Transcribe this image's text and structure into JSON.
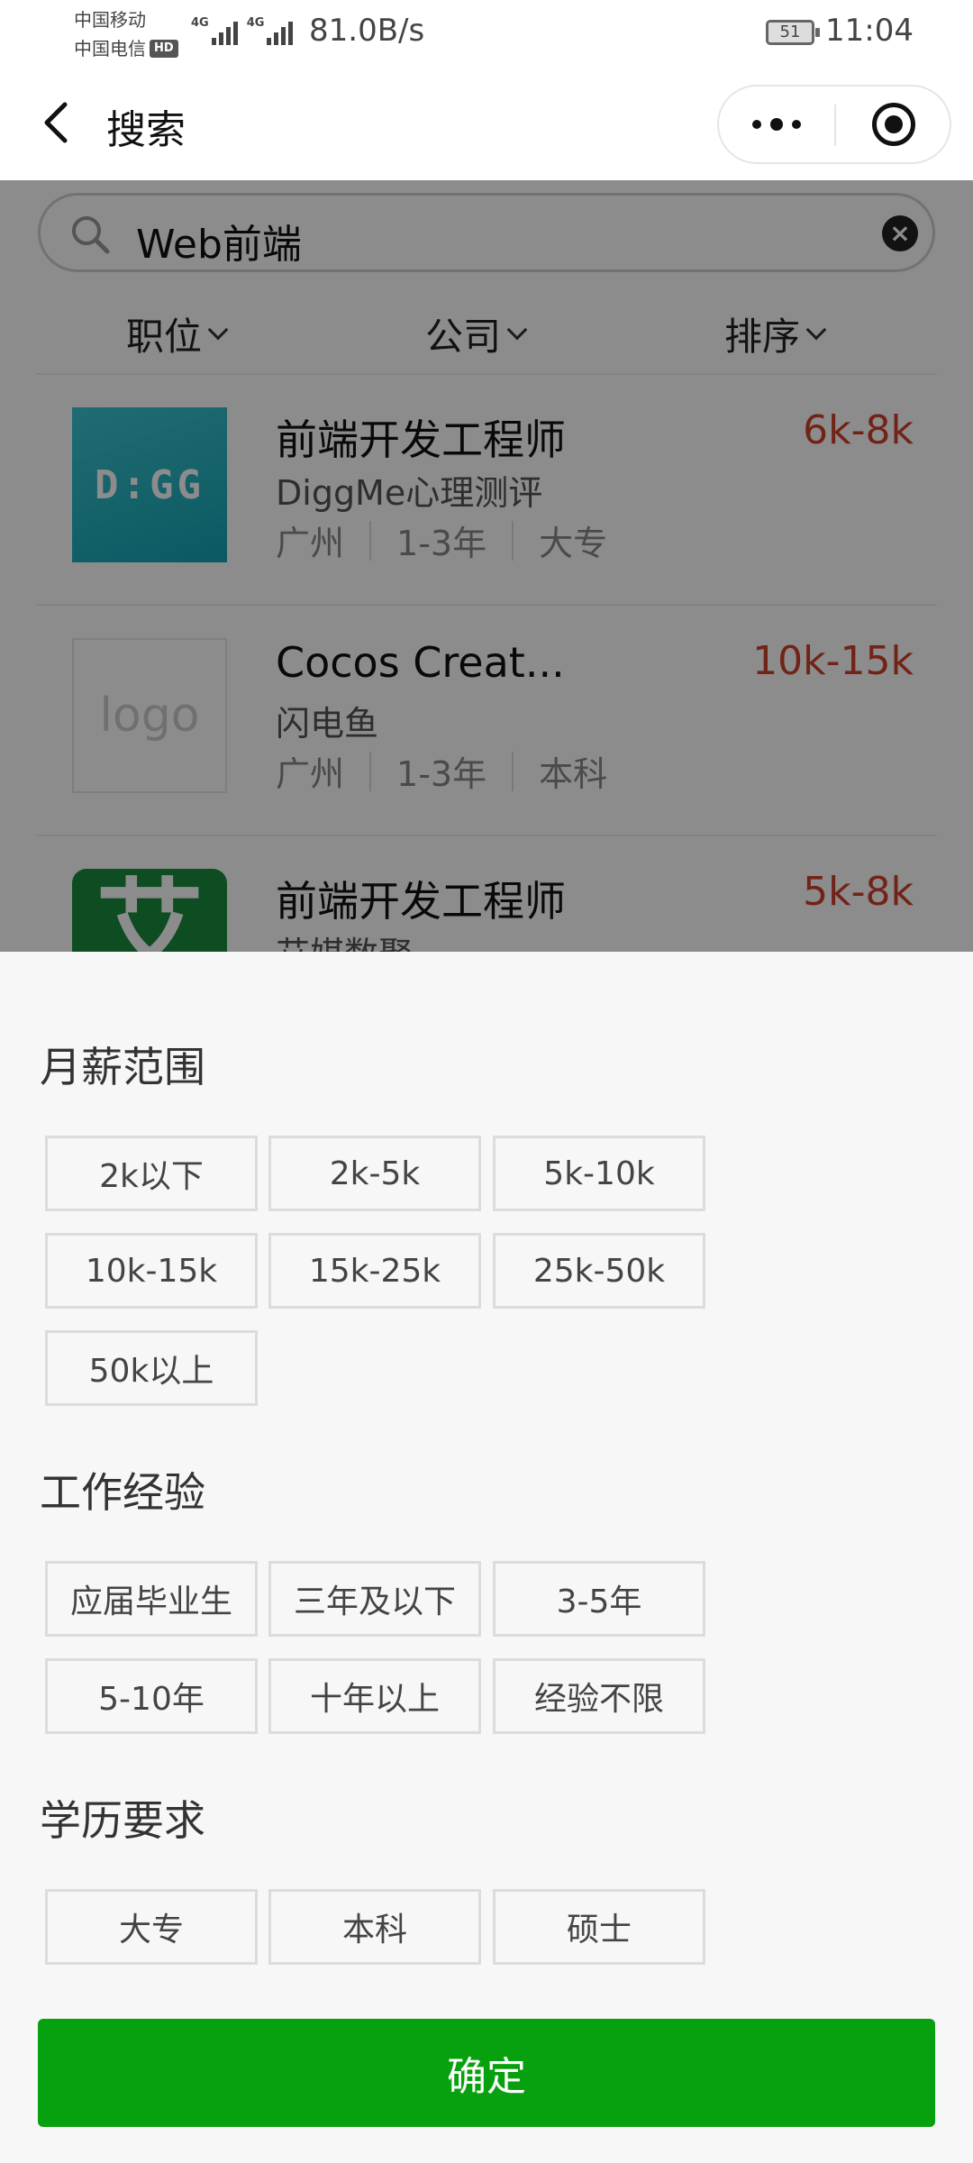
{
  "status_bar": {
    "carrier1": "中国移动",
    "carrier2": "中国电信",
    "hd": "HD",
    "net1": "4G",
    "net2": "4G",
    "speed": "81.0B/s",
    "battery": "51",
    "time": "11:04"
  },
  "nav": {
    "title": "搜索",
    "back_icon": "chevron-left-icon",
    "more_icon": "more-dots-icon",
    "close_icon": "target-circle-icon"
  },
  "search": {
    "query": "Web前端"
  },
  "filters": {
    "position": "职位",
    "company": "公司",
    "sort": "排序"
  },
  "jobs": [
    {
      "title": "前端开发工程师",
      "salary": "6k-8k",
      "company": "DiggMe心理测评",
      "city": "广州",
      "experience": "1-3年",
      "education": "大专",
      "logo_text": "D:GG"
    },
    {
      "title": "Cocos Creat...",
      "salary": "10k-15k",
      "company": "闪电鱼",
      "city": "广州",
      "experience": "1-3年",
      "education": "本科",
      "logo_text": "logo"
    },
    {
      "title": "前端开发工程师",
      "salary": "5k-8k",
      "company": "艾媒数聚",
      "logo_text": "艾"
    }
  ],
  "sheet": {
    "salary_title": "月薪范围",
    "salary_options": [
      "2k以下",
      "2k-5k",
      "5k-10k",
      "10k-15k",
      "15k-25k",
      "25k-50k",
      "50k以上"
    ],
    "experience_title": "工作经验",
    "experience_options": [
      "应届毕业生",
      "三年及以下",
      "3-5年",
      "5-10年",
      "十年以上",
      "经验不限"
    ],
    "education_title": "学历要求",
    "education_options": [
      "大专",
      "本科",
      "硕士"
    ],
    "confirm_label": "确定"
  },
  "colors": {
    "salary": "#d0412b",
    "confirm_bg": "#07a00f",
    "sheet_bg": "#f7f7f7"
  }
}
